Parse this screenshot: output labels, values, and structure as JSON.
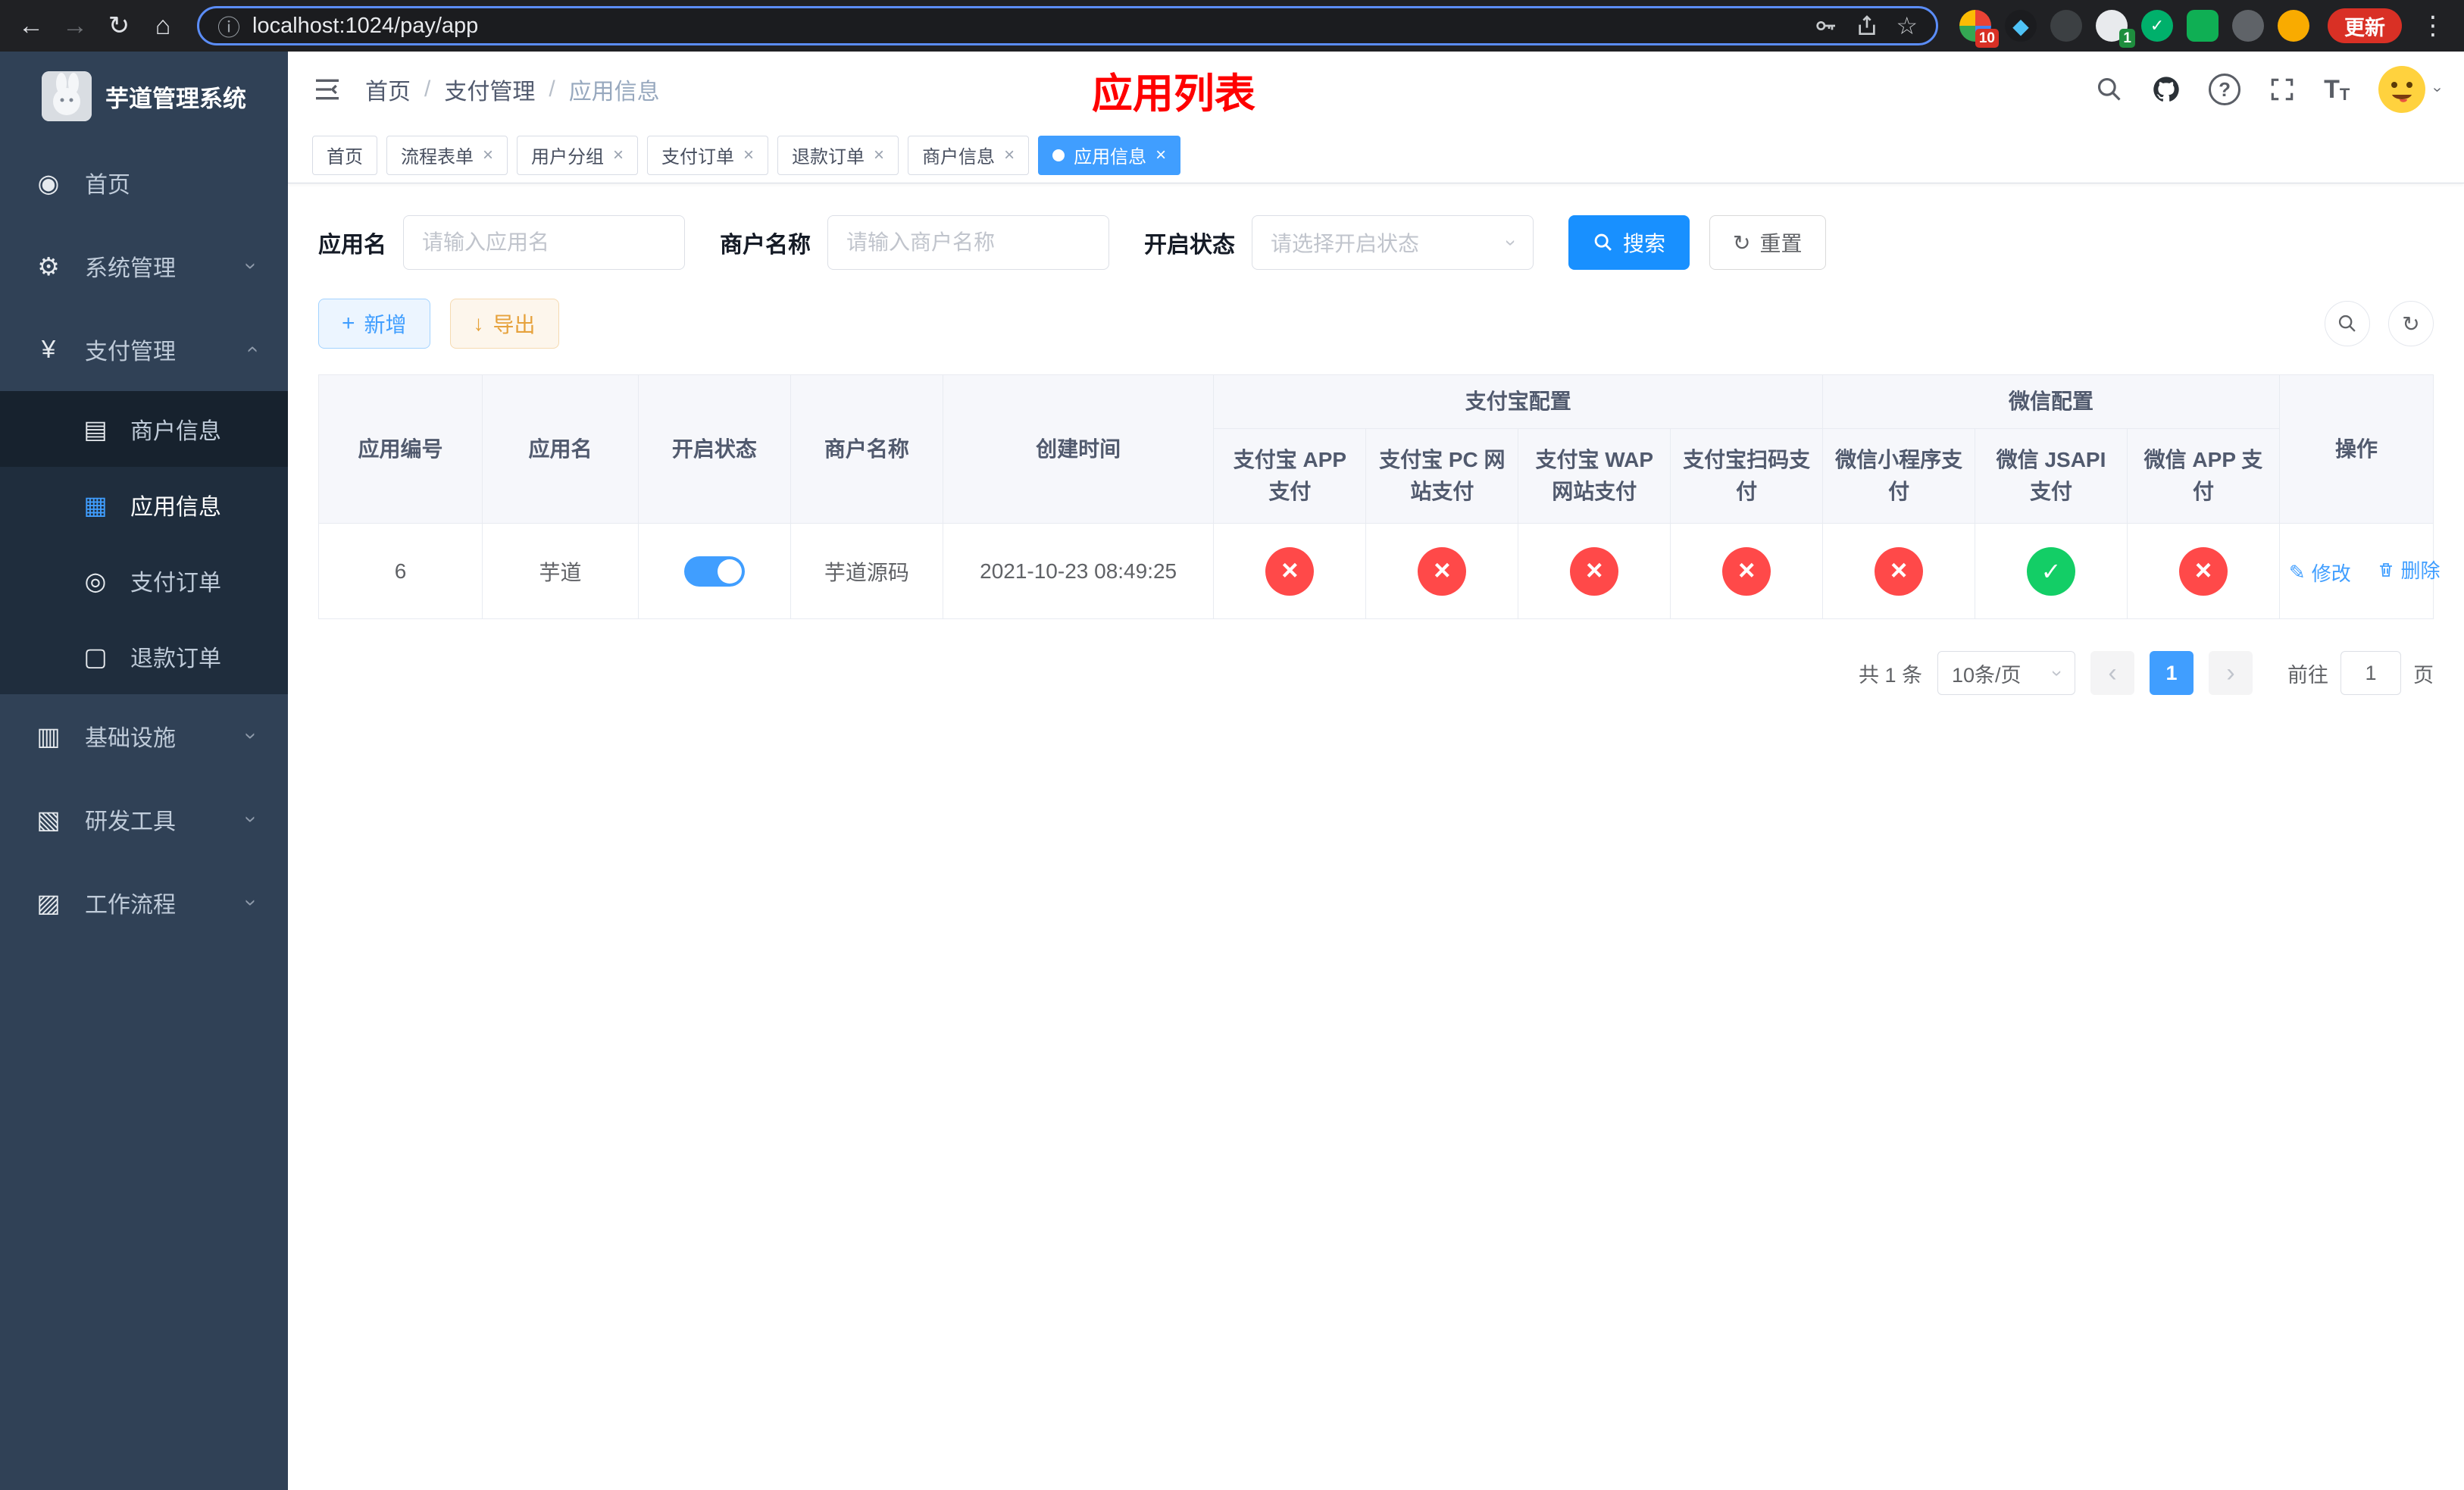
{
  "colors": {
    "accent": "#409eff",
    "search_blue": "#1890ff",
    "danger": "#ff4949",
    "success": "#13ce66",
    "warning": "#e6a23c",
    "title_red": "#ff0000"
  },
  "browser": {
    "url": "localhost:1024/pay/app",
    "update_label": "更新",
    "ext_badges": [
      "10",
      "1"
    ]
  },
  "sidebar": {
    "title": "芋道管理系统",
    "items": {
      "home": "首页",
      "system": "系统管理",
      "pay": "支付管理",
      "infra": "基础设施",
      "dev": "研发工具",
      "flow": "工作流程"
    },
    "pay_children": [
      "商户信息",
      "应用信息",
      "支付订单",
      "退款订单"
    ]
  },
  "header": {
    "breadcrumb": [
      "首页",
      "支付管理",
      "应用信息"
    ],
    "page_title": "应用列表"
  },
  "tabs": [
    {
      "label": "首页"
    },
    {
      "label": "流程表单"
    },
    {
      "label": "用户分组"
    },
    {
      "label": "支付订单"
    },
    {
      "label": "退款订单"
    },
    {
      "label": "商户信息"
    },
    {
      "label": "应用信息"
    }
  ],
  "filters": {
    "app_name_label": "应用名",
    "app_name_placeholder": "请输入应用名",
    "merchant_label": "商户名称",
    "merchant_placeholder": "请输入商户名称",
    "status_label": "开启状态",
    "status_placeholder": "请选择开启状态",
    "search_label": "搜索",
    "reset_label": "重置"
  },
  "toolbar": {
    "add_label": "新增",
    "export_label": "导出"
  },
  "table": {
    "columns": {
      "id": "应用编号",
      "name": "应用名",
      "status": "开启状态",
      "merchant": "商户名称",
      "created": "创建时间",
      "alipay_group": "支付宝配置",
      "wechat_group": "微信配置",
      "ops": "操作"
    },
    "sub_columns": [
      "支付宝 APP 支付",
      "支付宝 PC 网站支付",
      "支付宝 WAP 网站支付",
      "支付宝扫码支付",
      "微信小程序支付",
      "微信 JSAPI 支付",
      "微信 APP 支付"
    ],
    "row": {
      "id": "6",
      "name": "芋道",
      "status_on": "true",
      "merchant": "芋道源码",
      "created": "2021-10-23 08:49:25",
      "configs": [
        "error",
        "error",
        "error",
        "error",
        "error",
        "success",
        "error"
      ],
      "edit_label": "修改",
      "delete_label": "删除"
    }
  },
  "pagination": {
    "total": "共 1 条",
    "page_size": "10条/页",
    "current_page": "1",
    "goto_label": "前往",
    "goto_value": "1",
    "page_unit": "页"
  }
}
